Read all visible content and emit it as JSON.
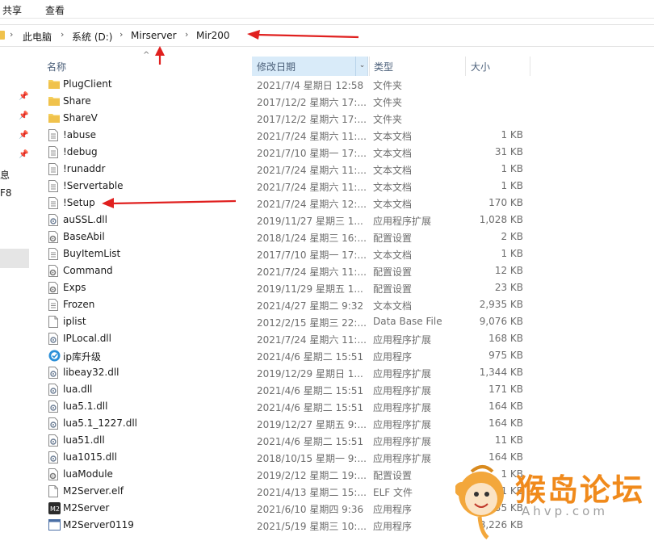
{
  "ribbon": {
    "tabs": [
      "共享",
      "查看"
    ]
  },
  "breadcrumb": [
    "此电脑",
    "系统 (D:)",
    "Mirserver",
    "Mir200"
  ],
  "nav": {
    "labels": [
      "息",
      "F8"
    ]
  },
  "columns": {
    "name": "名称",
    "date": "修改日期",
    "type": "类型",
    "size": "大小"
  },
  "files": [
    {
      "name": "PlugClient",
      "date": "2021/7/4 星期日 12:58",
      "type": "文件夹",
      "size": "",
      "icon": "folder-icon"
    },
    {
      "name": "Share",
      "date": "2017/12/2 星期六 17:...",
      "type": "文件夹",
      "size": "",
      "icon": "folder-icon"
    },
    {
      "name": "ShareV",
      "date": "2017/12/2 星期六 17:...",
      "type": "文件夹",
      "size": "",
      "icon": "folder-icon"
    },
    {
      "name": "!abuse",
      "date": "2021/7/24 星期六 11:...",
      "type": "文本文档",
      "size": "1 KB",
      "icon": "text-file-icon"
    },
    {
      "name": "!debug",
      "date": "2021/7/10 星期一 17:...",
      "type": "文本文档",
      "size": "31 KB",
      "icon": "text-file-icon"
    },
    {
      "name": "!runaddr",
      "date": "2021/7/24 星期六 11:...",
      "type": "文本文档",
      "size": "1 KB",
      "icon": "text-file-icon"
    },
    {
      "name": "!Servertable",
      "date": "2021/7/24 星期六 11:...",
      "type": "文本文档",
      "size": "1 KB",
      "icon": "text-file-icon"
    },
    {
      "name": "!Setup",
      "date": "2021/7/24 星期六 12:...",
      "type": "文本文档",
      "size": "170 KB",
      "icon": "text-file-icon"
    },
    {
      "name": "auSSL.dll",
      "date": "2019/11/27 星期三 1...",
      "type": "应用程序扩展",
      "size": "1,028 KB",
      "icon": "dll-file-icon"
    },
    {
      "name": "BaseAbil",
      "date": "2018/1/24 星期三 16:...",
      "type": "配置设置",
      "size": "2 KB",
      "icon": "config-file-icon"
    },
    {
      "name": "BuyItemList",
      "date": "2017/7/10 星期一 17:...",
      "type": "文本文档",
      "size": "1 KB",
      "icon": "text-file-icon"
    },
    {
      "name": "Command",
      "date": "2021/7/24 星期六 11:...",
      "type": "配置设置",
      "size": "12 KB",
      "icon": "config-file-icon"
    },
    {
      "name": "Exps",
      "date": "2019/11/29 星期五 1...",
      "type": "配置设置",
      "size": "23 KB",
      "icon": "config-file-icon"
    },
    {
      "name": "Frozen",
      "date": "2021/4/27 星期二 9:32",
      "type": "文本文档",
      "size": "2,935 KB",
      "icon": "text-file-icon"
    },
    {
      "name": "iplist",
      "date": "2012/2/15 星期三 22:...",
      "type": "Data Base File",
      "size": "9,076 KB",
      "icon": "blank-file-icon"
    },
    {
      "name": "IPLocal.dll",
      "date": "2021/7/24 星期六 11:...",
      "type": "应用程序扩展",
      "size": "168 KB",
      "icon": "dll-file-icon"
    },
    {
      "name": "ip库升级",
      "date": "2021/4/6 星期二 15:51",
      "type": "应用程序",
      "size": "975 KB",
      "icon": "app-globe-icon"
    },
    {
      "name": "libeay32.dll",
      "date": "2019/12/29 星期日 1...",
      "type": "应用程序扩展",
      "size": "1,344 KB",
      "icon": "dll-file-icon"
    },
    {
      "name": "lua.dll",
      "date": "2021/4/6 星期二 15:51",
      "type": "应用程序扩展",
      "size": "171 KB",
      "icon": "dll-file-icon"
    },
    {
      "name": "lua5.1.dll",
      "date": "2021/4/6 星期二 15:51",
      "type": "应用程序扩展",
      "size": "164 KB",
      "icon": "dll-file-icon"
    },
    {
      "name": "lua5.1_1227.dll",
      "date": "2019/12/27 星期五 9:...",
      "type": "应用程序扩展",
      "size": "164 KB",
      "icon": "dll-file-icon"
    },
    {
      "name": "lua51.dll",
      "date": "2021/4/6 星期二 15:51",
      "type": "应用程序扩展",
      "size": "11 KB",
      "icon": "dll-file-icon"
    },
    {
      "name": "lua1015.dll",
      "date": "2018/10/15 星期一 9:...",
      "type": "应用程序扩展",
      "size": "164 KB",
      "icon": "dll-file-icon"
    },
    {
      "name": "luaModule",
      "date": "2019/2/12 星期二 19:...",
      "type": "配置设置",
      "size": "1 KB",
      "icon": "config-file-icon"
    },
    {
      "name": "M2Server.elf",
      "date": "2021/4/13 星期二 15:...",
      "type": "ELF 文件",
      "size": "1 KB",
      "icon": "blank-file-icon"
    },
    {
      "name": "M2Server",
      "date": "2021/6/10 星期四 9:36",
      "type": "应用程序",
      "size": "955 KB",
      "icon": "app-m2-icon"
    },
    {
      "name": "M2Server0119",
      "date": "2021/5/19 星期三 10:...",
      "type": "应用程序",
      "size": "8,226 KB",
      "icon": "app-window-icon"
    }
  ],
  "watermark": {
    "title": "猴岛论坛",
    "subtitle": "Ahvp.com"
  },
  "colors": {
    "folder": "#f0c24c",
    "header_selected": "#d9ebf9",
    "arrow": "#e0201f",
    "watermark": "#f08a1c"
  }
}
